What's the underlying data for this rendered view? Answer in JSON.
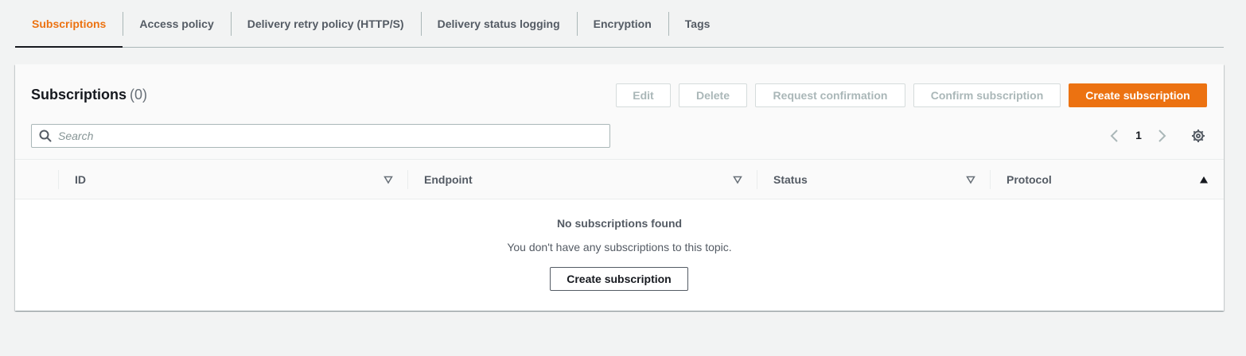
{
  "tabs": [
    {
      "label": "Subscriptions",
      "active": true
    },
    {
      "label": "Access policy",
      "active": false
    },
    {
      "label": "Delivery retry policy (HTTP/S)",
      "active": false
    },
    {
      "label": "Delivery status logging",
      "active": false
    },
    {
      "label": "Encryption",
      "active": false
    },
    {
      "label": "Tags",
      "active": false
    }
  ],
  "panel": {
    "title": "Subscriptions",
    "count": "(0)"
  },
  "actions": {
    "edit": "Edit",
    "delete": "Delete",
    "request_confirmation": "Request confirmation",
    "confirm_subscription": "Confirm subscription",
    "create_subscription": "Create subscription"
  },
  "search": {
    "placeholder": "Search",
    "value": "",
    "icon": "search-icon"
  },
  "pagination": {
    "current_page": "1",
    "prev_icon": "chevron-left-icon",
    "next_icon": "chevron-right-icon",
    "settings_icon": "gear-icon"
  },
  "table": {
    "columns": [
      {
        "label": "ID",
        "sort": "none"
      },
      {
        "label": "Endpoint",
        "sort": "none"
      },
      {
        "label": "Status",
        "sort": "none"
      },
      {
        "label": "Protocol",
        "sort": "ascending"
      }
    ],
    "rows": []
  },
  "empty_state": {
    "title": "No subscriptions found",
    "description": "You don't have any subscriptions to this topic.",
    "button": "Create subscription"
  },
  "colors": {
    "accent": "#ec7211",
    "background": "#f2f3f3",
    "text_muted": "#545b64",
    "disabled": "#aab7b8"
  }
}
